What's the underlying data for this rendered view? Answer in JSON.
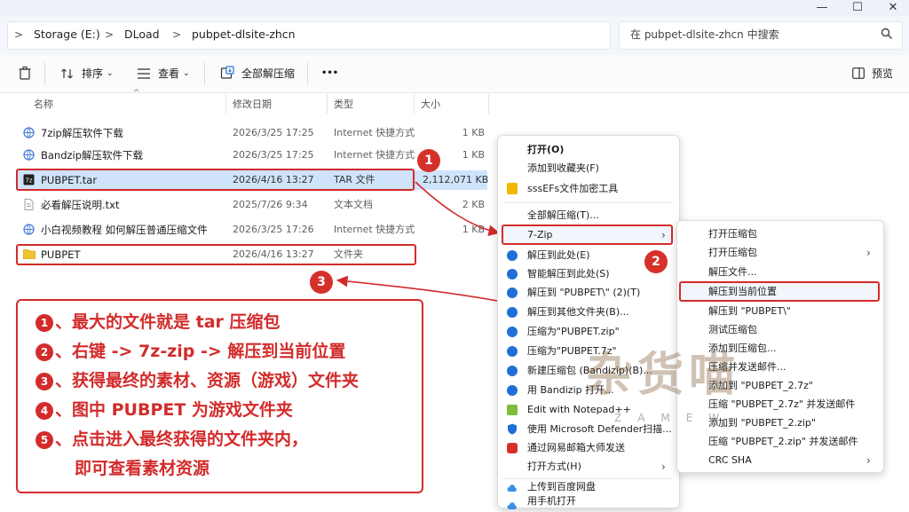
{
  "window": {
    "minimize_glyph": "—",
    "maximize_glyph": "☐",
    "close_glyph": "✕"
  },
  "address": {
    "crumbs": [
      "Storage (E:)",
      "DLoad",
      "pubpet-dlsite-zhcn"
    ],
    "separator": ">"
  },
  "search": {
    "placeholder": "在 pubpet-dlsite-zhcn 中搜索"
  },
  "toolbar": {
    "sort_label": "排序",
    "view_label": "查看",
    "extract_all_label": "全部解压缩",
    "more_label": "•••",
    "preview_label": "预览"
  },
  "columns": {
    "name": "名称",
    "modified": "修改日期",
    "type": "类型",
    "size": "大小"
  },
  "files": [
    {
      "name": "7zip解压软件下载",
      "modified": "2026/3/25 17:25",
      "type": "Internet 快捷方式",
      "size": "1 KB",
      "icon": "internet-shortcut-icon",
      "color": "#4a7fd6"
    },
    {
      "name": "Bandzip解压软件下载",
      "modified": "2026/3/25 17:25",
      "type": "Internet 快捷方式",
      "size": "1 KB",
      "icon": "internet-shortcut-icon",
      "color": "#4a7fd6"
    },
    {
      "name": "PUBPET.tar",
      "modified": "2026/4/16 13:27",
      "type": "TAR 文件",
      "size": "2,112,071 KB",
      "icon": "7z-archive-icon",
      "color": "#1f1f1f"
    },
    {
      "name": "必看解压说明.txt",
      "modified": "2025/7/26 9:34",
      "type": "文本文档",
      "size": "2 KB",
      "icon": "text-file-icon",
      "color": "#9aa3ad"
    },
    {
      "name": "小白视频教程 如何解压普通压缩文件",
      "modified": "2026/3/25 17:26",
      "type": "Internet 快捷方式",
      "size": "1 KB",
      "icon": "internet-shortcut-icon",
      "color": "#4a7fd6"
    },
    {
      "name": "PUBPET",
      "modified": "2026/4/16 13:27",
      "type": "文件夹",
      "size": "",
      "icon": "folder-icon",
      "color": "#f4c430"
    }
  ],
  "context_menu": {
    "items": [
      {
        "label": "打开(O)",
        "bold": true
      },
      {
        "label": "添加到收藏夹(F)"
      },
      {
        "label": "sssEFs文件加密工具",
        "icon": "encrypt-tool-icon"
      },
      {
        "divider": true
      },
      {
        "label": "全部解压缩(T)..."
      },
      {
        "label": "7-Zip",
        "submenu": true,
        "highlight": true
      },
      {
        "label": "解压到此处(E)",
        "icon": "bandizip-icon"
      },
      {
        "label": "智能解压到此处(S)",
        "icon": "bandizip-icon"
      },
      {
        "label": "解压到 \"PUBPET\\\" (2)(T)",
        "icon": "bandizip-icon"
      },
      {
        "label": "解压到其他文件夹(B)...",
        "icon": "bandizip-icon"
      },
      {
        "label": "压缩为\"PUBPET.zip\"",
        "icon": "bandizip-icon"
      },
      {
        "label": "压缩为\"PUBPET.7z\"",
        "icon": "bandizip-icon"
      },
      {
        "label": "新建压缩包 (Bandizip)(B)...",
        "icon": "bandizip-icon"
      },
      {
        "label": "用 Bandizip 打开...",
        "icon": "bandizip-icon"
      },
      {
        "label": "Edit with Notepad++",
        "icon": "notepad-icon"
      },
      {
        "label": "使用 Microsoft Defender扫描...",
        "icon": "defender-icon"
      },
      {
        "label": "通过网易邮箱大师发送",
        "icon": "netease-mail-icon"
      },
      {
        "label": "打开方式(H)",
        "submenu": true
      },
      {
        "divider": true
      },
      {
        "label": "上传到百度网盘",
        "icon": "baidu-cloud-icon"
      },
      {
        "label": "用手机打开",
        "icon": "baidu-cloud-icon"
      }
    ]
  },
  "submenu": {
    "items": [
      {
        "label": "打开压缩包"
      },
      {
        "label": "打开压缩包",
        "submenu": true
      },
      {
        "label": "解压文件..."
      },
      {
        "label": "解压到当前位置",
        "highlight": true
      },
      {
        "label": "解压到 \"PUBPET\\\""
      },
      {
        "label": "测试压缩包"
      },
      {
        "label": "添加到压缩包..."
      },
      {
        "label": "压缩并发送邮件..."
      },
      {
        "label": "添加到 \"PUBPET_2.7z\""
      },
      {
        "label": "压缩 \"PUBPET_2.7z\" 并发送邮件"
      },
      {
        "label": "添加到 \"PUBPET_2.zip\""
      },
      {
        "label": "压缩 \"PUBPET_2.zip\" 并发送邮件"
      },
      {
        "label": "CRC SHA",
        "submenu": true
      }
    ]
  },
  "badges": [
    "1",
    "2",
    "3"
  ],
  "steps": [
    {
      "num": "1",
      "text": "、最大的文件就是 tar 压缩包"
    },
    {
      "num": "2",
      "text": "、右键 -> 7z-zip -> 解压到当前位置"
    },
    {
      "num": "3",
      "text": "、获得最终的素材、资源（游戏）文件夹"
    },
    {
      "num": "4",
      "text": "、图中 PUBPET 为游戏文件夹"
    },
    {
      "num": "5",
      "text": "、点击进入最终获得的文件夹内，"
    },
    {
      "num": "",
      "text": "即可查看素材资源"
    }
  ],
  "watermark": {
    "text": "杂货喵",
    "sub": "ZAMEW"
  },
  "colors": {
    "accent_red": "#d32b2b",
    "selection": "#cfe3fb",
    "menu_icon_blue": "#1f6fd6"
  }
}
